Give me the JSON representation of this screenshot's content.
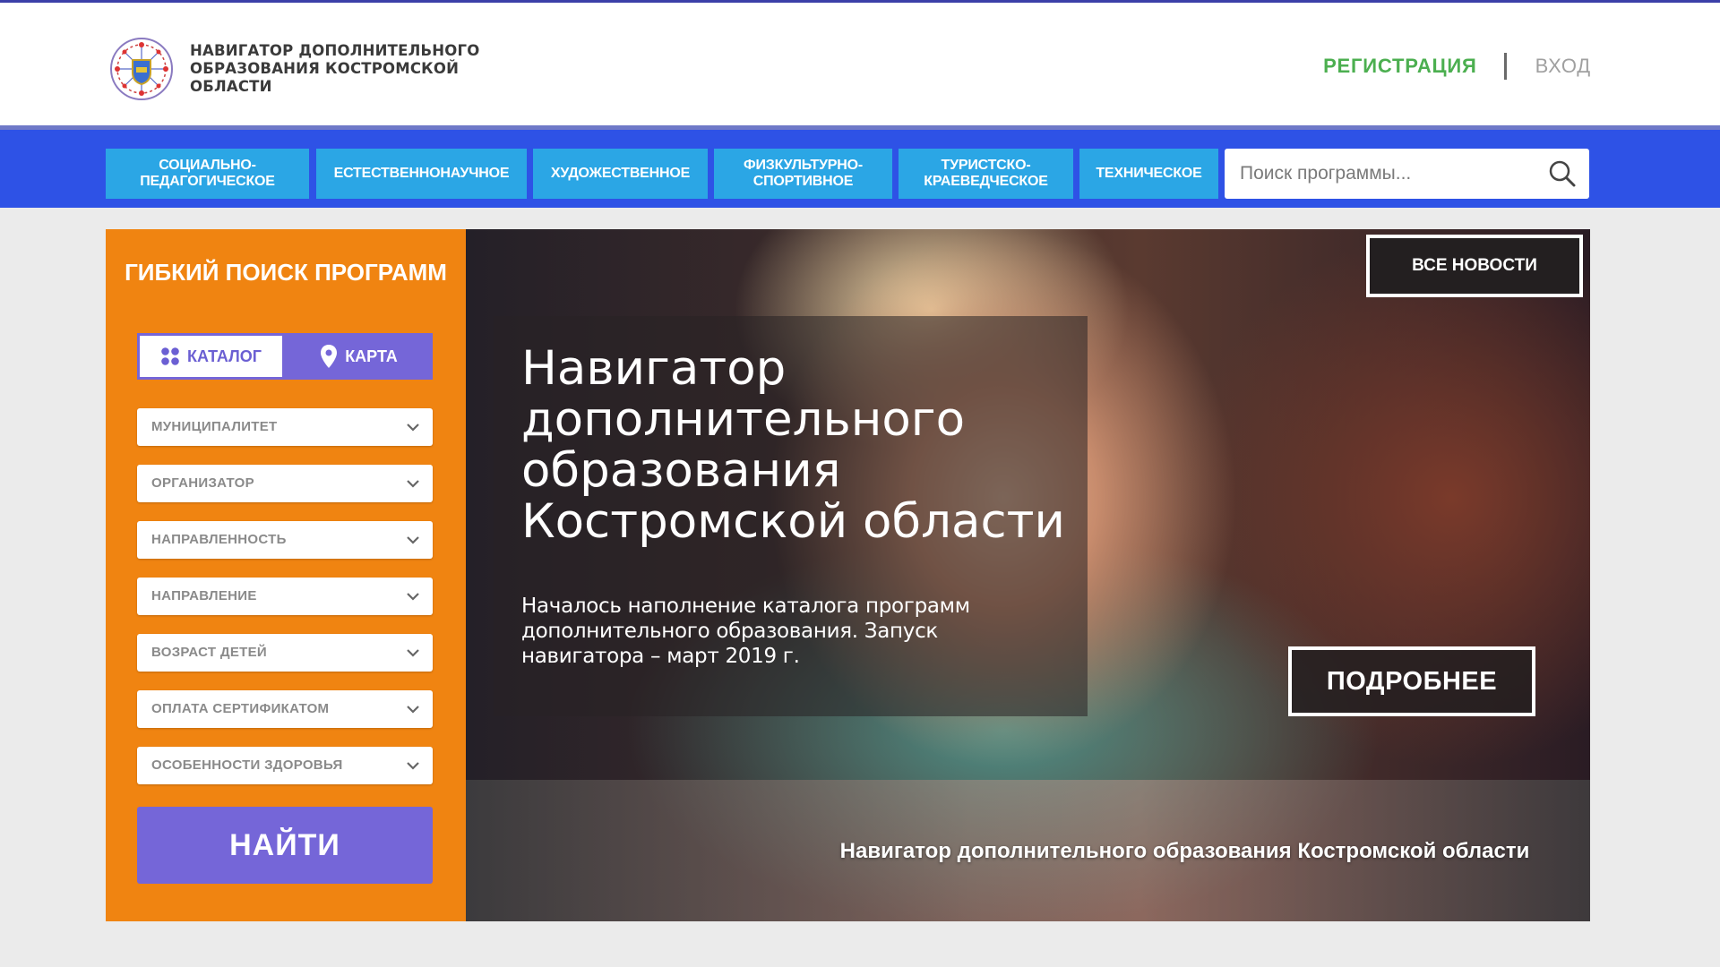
{
  "header": {
    "brand_text": "НАВИГАТОР ДОПОЛНИТЕЛЬНОГО ОБРАЗОВАНИЯ КОСТРОМСКОЙ ОБЛАСТИ",
    "register_label": "РЕГИСТРАЦИЯ",
    "login_label": "ВХОД"
  },
  "nav": {
    "items": [
      {
        "label": "СОЦИАЛЬНО-ПЕДАГОГИЧЕСКОЕ"
      },
      {
        "label": "ЕСТЕСТВЕННОНАУЧНОЕ"
      },
      {
        "label": "ХУДОЖЕСТВЕННОЕ"
      },
      {
        "label": "ФИЗКУЛЬТУРНО-СПОРТИВНОЕ"
      },
      {
        "label": "ТУРИСТСКО-КРАЕВЕДЧЕСКОЕ"
      },
      {
        "label": "ТЕХНИЧЕСКОЕ"
      }
    ],
    "search_placeholder": "Поиск программы..."
  },
  "sidebar": {
    "title": "ГИБКИЙ ПОИСК ПРОГРАММ",
    "catalog_label": "КАТАЛОГ",
    "map_label": "КАРТА",
    "filters": [
      {
        "label": "МУНИЦИПАЛИТЕТ"
      },
      {
        "label": "ОРГАНИЗАТОР"
      },
      {
        "label": "НАПРАВЛЕННОСТЬ"
      },
      {
        "label": "НАПРАВЛЕНИЕ"
      },
      {
        "label": "ВОЗРАСТ ДЕТЕЙ"
      },
      {
        "label": "ОПЛАТА СЕРТИФИКАТОМ"
      },
      {
        "label": "ОСОБЕННОСТИ ЗДОРОВЬЯ"
      }
    ],
    "find_label": "НАЙТИ"
  },
  "hero": {
    "all_news_label": "ВСЕ НОВОСТИ",
    "title": "Навигатор дополнительного образования Костромской области",
    "text": "Началось наполнение каталога программ дополнительного образования. Запуск навигатора – март 2019 г.",
    "more_label": "ПОДРОБНЕЕ",
    "strip_text": "Навигатор дополнительного образования Костромской области"
  },
  "colors": {
    "nav_blue": "#2e52e6",
    "nav_button": "#2ba6e5",
    "sidebar_orange": "#f08411",
    "accent_purple": "#7566d8",
    "register_green": "#4caf50"
  }
}
